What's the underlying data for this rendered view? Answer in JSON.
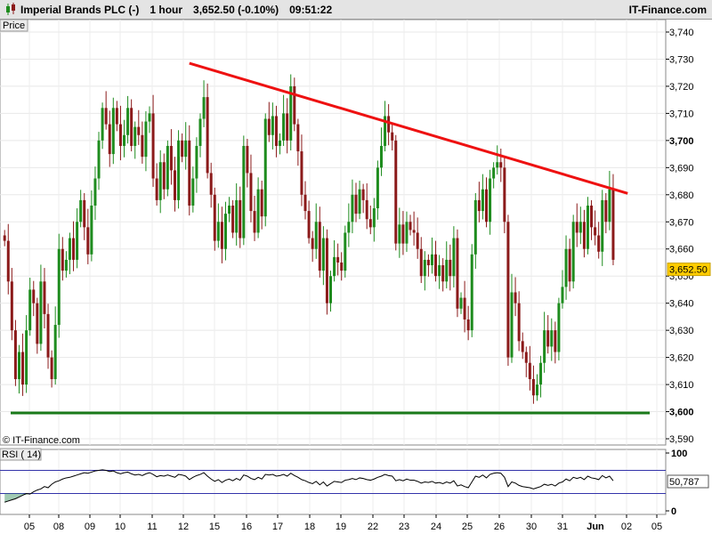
{
  "header": {
    "instrument": "Imperial Brands PLC (-)",
    "timeframe": "1 hour",
    "price_change": "3,652.50 (-0.10%)",
    "time": "09:51:22",
    "brand": "IT-Finance.com"
  },
  "panels": {
    "price_label": "Price",
    "copyright": "© IT-Finance.com",
    "rsi_label": "RSI ( 14)"
  },
  "colors": {
    "up_candle": "#1e8c1e",
    "down_candle": "#8b1a1a",
    "resistance_line": "#ee1111",
    "support_line": "#1a7a1a",
    "rsi_line": "#000000",
    "rsi_bands": "#3333aa",
    "rsi_fill": "#2e8b57"
  },
  "chart_data": [
    {
      "type": "candlestick",
      "panel": "price",
      "ylim": [
        3588,
        3745
      ],
      "y_ticks": [
        "3,740",
        "3,730",
        "3,720",
        "3,710",
        "3,700",
        "3,690",
        "3,680",
        "3,670",
        "3,660",
        "3,650",
        "3,640",
        "3,630",
        "3,620",
        "3,610",
        "3,600",
        "3,590"
      ],
      "bold_ticks": [
        "3,700",
        "3,600"
      ],
      "x_tick_labels": [
        "05",
        "08",
        "09",
        "10",
        "11",
        "12",
        "15",
        "16",
        "17",
        "18",
        "19",
        "22",
        "23",
        "24",
        "25",
        "26",
        "30",
        "31",
        "Jun",
        "02",
        "05"
      ],
      "last_price_label": "3,652.50",
      "last_price": 3652.5,
      "bars_per_day": 9,
      "closes": [
        3663,
        3648,
        3630,
        3612,
        3622,
        3610,
        3630,
        3645,
        3640,
        3625,
        3648,
        3636,
        3620,
        3612,
        3632,
        3660,
        3652,
        3656,
        3664,
        3656,
        3670,
        3678,
        3668,
        3658,
        3676,
        3686,
        3700,
        3712,
        3706,
        3695,
        3712,
        3706,
        3698,
        3702,
        3712,
        3698,
        3705,
        3702,
        3694,
        3707,
        3710,
        3686,
        3678,
        3692,
        3682,
        3698,
        3689,
        3678,
        3700,
        3694,
        3700,
        3676,
        3686,
        3698,
        3708,
        3716,
        3688,
        3680,
        3663,
        3670,
        3660,
        3673,
        3676,
        3666,
        3678,
        3664,
        3698,
        3688,
        3674,
        3666,
        3682,
        3672,
        3708,
        3702,
        3709,
        3698,
        3700,
        3710,
        3700,
        3720,
        3706,
        3696,
        3680,
        3674,
        3664,
        3660,
        3670,
        3652,
        3664,
        3640,
        3650,
        3657,
        3655,
        3652,
        3666,
        3670,
        3680,
        3673,
        3682,
        3678,
        3671,
        3668,
        3675,
        3690,
        3698,
        3709,
        3703,
        3700,
        3662,
        3669,
        3662,
        3670,
        3667,
        3666,
        3660,
        3650,
        3656,
        3654,
        3658,
        3650,
        3654,
        3648,
        3656,
        3650,
        3664,
        3638,
        3642,
        3634,
        3630,
        3658,
        3678,
        3674,
        3682,
        3670,
        3686,
        3690,
        3692,
        3690,
        3670,
        3620,
        3644,
        3640,
        3626,
        3622,
        3618,
        3612,
        3606,
        3610,
        3618,
        3630,
        3624,
        3630,
        3622,
        3640,
        3646,
        3660,
        3648,
        3670,
        3666,
        3670,
        3660,
        3676,
        3668,
        3665,
        3659,
        3678,
        3670,
        3682,
        3656
      ],
      "resistance_line": {
        "from_bar": 51,
        "from_price": 3728.5,
        "to_bar": 172,
        "to_price": 3680.5
      },
      "support_line": {
        "from_bar": 0,
        "to_bar": 172,
        "price": 3599.5
      }
    },
    {
      "type": "line",
      "panel": "rsi",
      "name": "RSI ( 14)",
      "ylim": [
        0,
        100
      ],
      "y_ticks": [
        "100",
        "0"
      ],
      "bands": [
        70,
        30
      ],
      "last_value_label": "50,787",
      "last_value": 50.787,
      "values": [
        15,
        17,
        19,
        21,
        24,
        27,
        30,
        29,
        33,
        36,
        38,
        42,
        40,
        46,
        50,
        52,
        55,
        57,
        58,
        60,
        62,
        64,
        66,
        65,
        67,
        69,
        70,
        71,
        70,
        68,
        69,
        66,
        64,
        66,
        67,
        64,
        62,
        63,
        61,
        64,
        66,
        63,
        59,
        61,
        60,
        62,
        60,
        58,
        63,
        62,
        60,
        54,
        58,
        61,
        63,
        66,
        60,
        55,
        51,
        54,
        49,
        53,
        55,
        52,
        56,
        53,
        62,
        60,
        56,
        54,
        58,
        55,
        63,
        62,
        63,
        60,
        61,
        63,
        60,
        65,
        61,
        58,
        54,
        52,
        49,
        47,
        51,
        45,
        50,
        43,
        47,
        51,
        50,
        49,
        53,
        54,
        56,
        54,
        57,
        56,
        54,
        53,
        55,
        58,
        60,
        63,
        61,
        60,
        52,
        54,
        52,
        55,
        53,
        53,
        51,
        48,
        50,
        49,
        51,
        48,
        49,
        47,
        50,
        48,
        52,
        43,
        45,
        42,
        40,
        50,
        60,
        58,
        62,
        57,
        63,
        65,
        66,
        65,
        58,
        42,
        50,
        48,
        44,
        42,
        41,
        40,
        38,
        40,
        42,
        46,
        44,
        46,
        43,
        48,
        50,
        55,
        52,
        58,
        56,
        58,
        54,
        60,
        57,
        56,
        54,
        61,
        57,
        60,
        52
      ]
    }
  ]
}
